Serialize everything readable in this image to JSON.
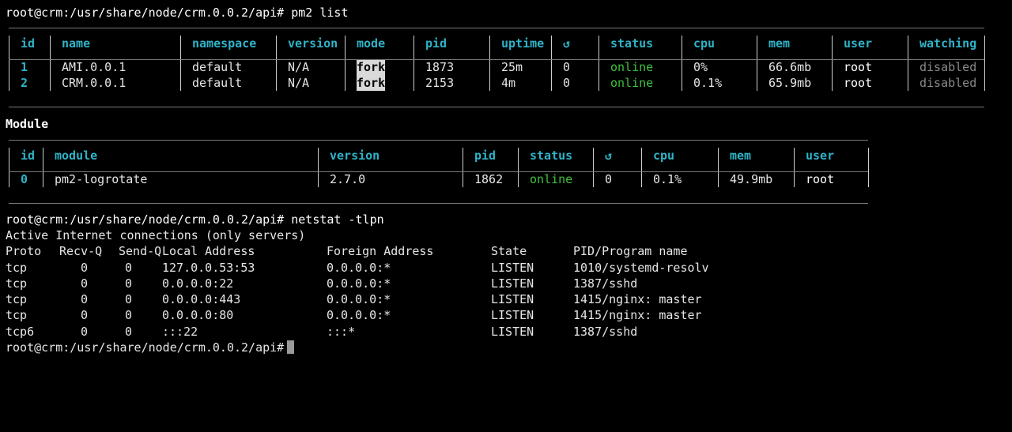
{
  "prompt1": "root@crm:/usr/share/node/crm.0.0.2/api# pm2 list",
  "pm2": {
    "headers": [
      "id",
      "name",
      "namespace",
      "version",
      "mode",
      "pid",
      "uptime",
      "↺",
      "status",
      "cpu",
      "mem",
      "user",
      "watching"
    ],
    "rows": [
      {
        "id": "1",
        "name": "AMI.0.0.1",
        "namespace": "default",
        "version": "N/A",
        "mode": "fork",
        "pid": "1873",
        "uptime": "25m",
        "restarts": "0",
        "status": "online",
        "cpu": "0%",
        "mem": "66.6mb",
        "user": "root",
        "watching": "disabled"
      },
      {
        "id": "2",
        "name": "CRM.0.0.1",
        "namespace": "default",
        "version": "N/A",
        "mode": "fork",
        "pid": "2153",
        "uptime": "4m",
        "restarts": "0",
        "status": "online",
        "cpu": "0.1%",
        "mem": "65.9mb",
        "user": "root",
        "watching": "disabled"
      }
    ]
  },
  "module_title": "Module",
  "module": {
    "headers": [
      "id",
      "module",
      "version",
      "pid",
      "status",
      "↺",
      "cpu",
      "mem",
      "user"
    ],
    "rows": [
      {
        "id": "0",
        "module": "pm2-logrotate",
        "version": "2.7.0",
        "pid": "1862",
        "status": "online",
        "restarts": "0",
        "cpu": "0.1%",
        "mem": "49.9mb",
        "user": "root"
      }
    ]
  },
  "prompt2": "root@crm:/usr/share/node/crm.0.0.2/api# netstat -tlpn",
  "netstat": {
    "title": "Active Internet connections (only servers)",
    "headers": [
      "Proto",
      "Recv-Q",
      "Send-Q",
      "Local Address",
      "Foreign Address",
      "State",
      "PID/Program name"
    ],
    "rows": [
      [
        "tcp",
        "0",
        "0",
        "127.0.0.53:53",
        "0.0.0.0:*",
        "LISTEN",
        "1010/systemd-resolv"
      ],
      [
        "tcp",
        "0",
        "0",
        "0.0.0.0:22",
        "0.0.0.0:*",
        "LISTEN",
        "1387/sshd"
      ],
      [
        "tcp",
        "0",
        "0",
        "0.0.0.0:443",
        "0.0.0.0:*",
        "LISTEN",
        "1415/nginx: master"
      ],
      [
        "tcp",
        "0",
        "0",
        "0.0.0.0:80",
        "0.0.0.0:*",
        "LISTEN",
        "1415/nginx: master"
      ],
      [
        "tcp6",
        "0",
        "0",
        ":::22",
        ":::*",
        "LISTEN",
        "1387/sshd"
      ]
    ]
  },
  "prompt3": "root@crm:/usr/share/node/crm.0.0.2/api#",
  "colors": {
    "background": "#000000",
    "header": "#2fb3c8",
    "online": "#3fc13f",
    "text": "#e6e6e6",
    "dim": "#8a8a8a"
  }
}
